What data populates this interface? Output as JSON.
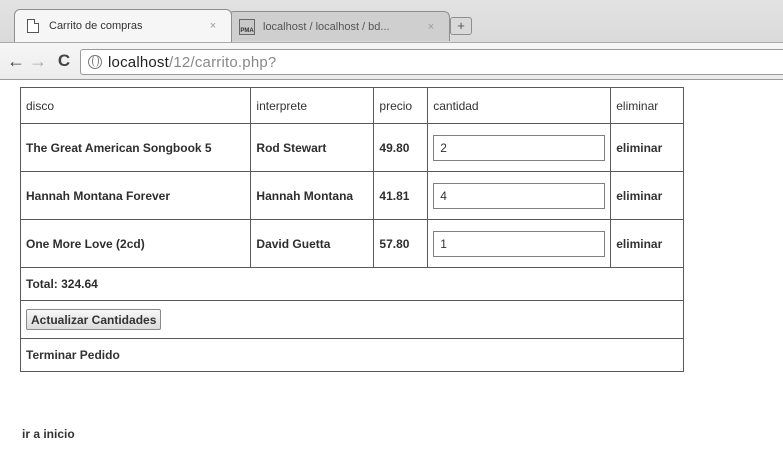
{
  "browser": {
    "tabs": [
      {
        "title": "Carrito de compras",
        "favicon": "document-icon",
        "close": "×"
      },
      {
        "title": "localhost / localhost / bd...",
        "favicon": "phpmyadmin-icon",
        "close": "×"
      }
    ],
    "new_tab": "+",
    "url_host": "localhost",
    "url_path": "/12/carrito.php?"
  },
  "cart": {
    "headers": {
      "disco": "disco",
      "interprete": "interprete",
      "precio": "precio",
      "cantidad": "cantidad",
      "eliminar": "eliminar"
    },
    "rows": [
      {
        "disco": "The Great American Songbook 5",
        "interprete": "Rod Stewart",
        "precio": "49.80",
        "cantidad": "2",
        "eliminar": "eliminar"
      },
      {
        "disco": "Hannah Montana Forever",
        "interprete": "Hannah Montana",
        "precio": "41.81",
        "cantidad": "4",
        "eliminar": "eliminar"
      },
      {
        "disco": "One More Love (2cd)",
        "interprete": "David Guetta",
        "precio": "57.80",
        "cantidad": "1",
        "eliminar": "eliminar"
      }
    ],
    "total": "Total: 324.64",
    "update_button": "Actualizar Cantidades",
    "finish_link": "Terminar Pedido"
  },
  "home_link": "ir a inicio"
}
